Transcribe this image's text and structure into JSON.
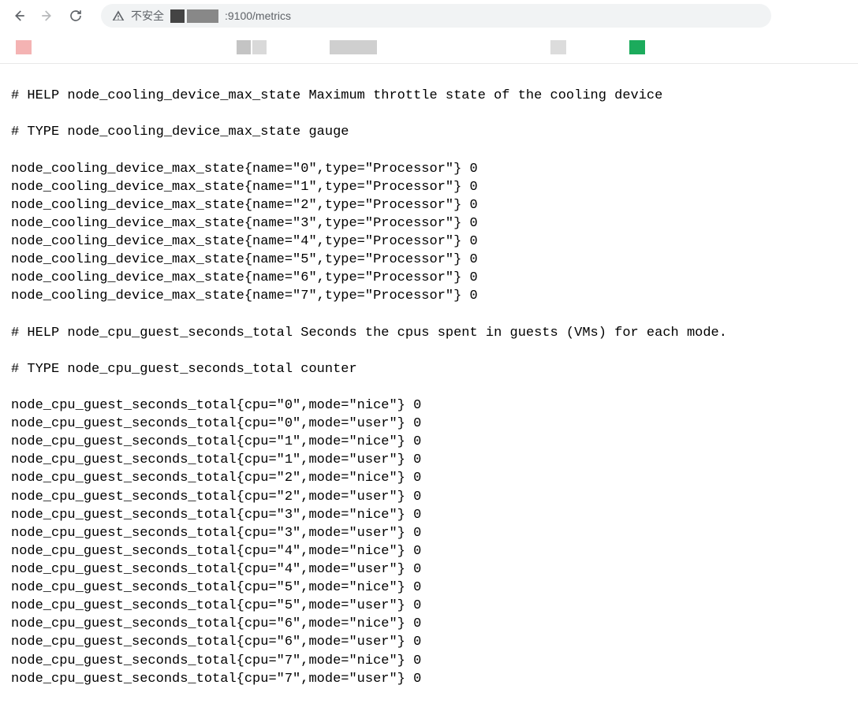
{
  "toolbar": {
    "insecure_label": "不安全",
    "url_suffix": ":9100/metrics"
  },
  "metrics": {
    "help_cooling": "# HELP node_cooling_device_max_state Maximum throttle state of the cooling device",
    "type_cooling": "# TYPE node_cooling_device_max_state gauge",
    "cooling_lines": [
      "node_cooling_device_max_state{name=\"0\",type=\"Processor\"} 0",
      "node_cooling_device_max_state{name=\"1\",type=\"Processor\"} 0",
      "node_cooling_device_max_state{name=\"2\",type=\"Processor\"} 0",
      "node_cooling_device_max_state{name=\"3\",type=\"Processor\"} 0",
      "node_cooling_device_max_state{name=\"4\",type=\"Processor\"} 0",
      "node_cooling_device_max_state{name=\"5\",type=\"Processor\"} 0",
      "node_cooling_device_max_state{name=\"6\",type=\"Processor\"} 0",
      "node_cooling_device_max_state{name=\"7\",type=\"Processor\"} 0"
    ],
    "help_cpu_guest": "# HELP node_cpu_guest_seconds_total Seconds the cpus spent in guests (VMs) for each mode.",
    "type_cpu_guest": "# TYPE node_cpu_guest_seconds_total counter",
    "cpu_guest_lines": [
      "node_cpu_guest_seconds_total{cpu=\"0\",mode=\"nice\"} 0",
      "node_cpu_guest_seconds_total{cpu=\"0\",mode=\"user\"} 0",
      "node_cpu_guest_seconds_total{cpu=\"1\",mode=\"nice\"} 0",
      "node_cpu_guest_seconds_total{cpu=\"1\",mode=\"user\"} 0",
      "node_cpu_guest_seconds_total{cpu=\"2\",mode=\"nice\"} 0",
      "node_cpu_guest_seconds_total{cpu=\"2\",mode=\"user\"} 0",
      "node_cpu_guest_seconds_total{cpu=\"3\",mode=\"nice\"} 0",
      "node_cpu_guest_seconds_total{cpu=\"3\",mode=\"user\"} 0",
      "node_cpu_guest_seconds_total{cpu=\"4\",mode=\"nice\"} 0",
      "node_cpu_guest_seconds_total{cpu=\"4\",mode=\"user\"} 0",
      "node_cpu_guest_seconds_total{cpu=\"5\",mode=\"nice\"} 0",
      "node_cpu_guest_seconds_total{cpu=\"5\",mode=\"user\"} 0",
      "node_cpu_guest_seconds_total{cpu=\"6\",mode=\"nice\"} 0",
      "node_cpu_guest_seconds_total{cpu=\"6\",mode=\"user\"} 0",
      "node_cpu_guest_seconds_total{cpu=\"7\",mode=\"nice\"} 0",
      "node_cpu_guest_seconds_total{cpu=\"7\",mode=\"user\"} 0"
    ]
  }
}
